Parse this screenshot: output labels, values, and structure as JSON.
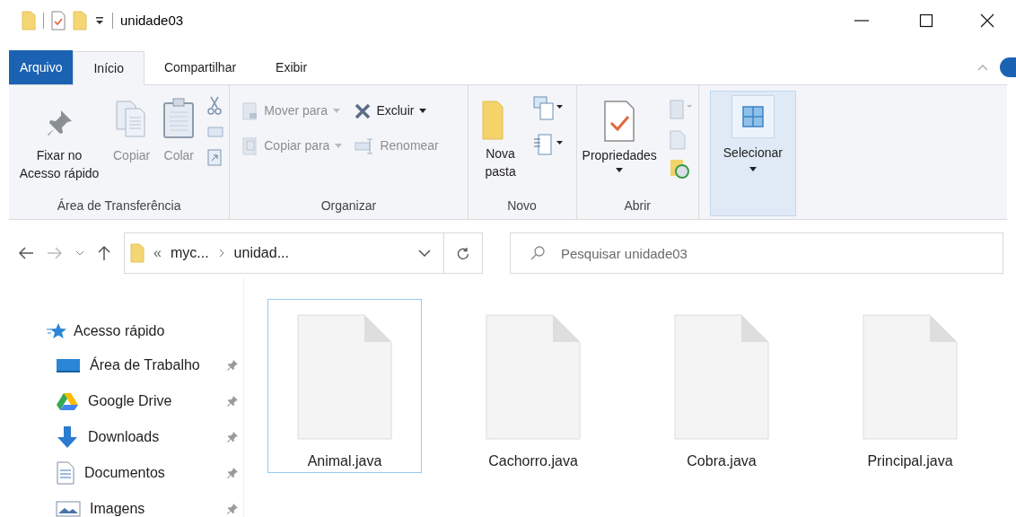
{
  "window": {
    "title": "unidade03"
  },
  "tabs": [
    {
      "label": "Arquivo",
      "kind": "file"
    },
    {
      "label": "Início",
      "kind": "tab",
      "selected": true
    },
    {
      "label": "Compartilhar",
      "kind": "tab",
      "selected": false
    },
    {
      "label": "Exibir",
      "kind": "tab",
      "selected": false
    }
  ],
  "ribbon": {
    "groups": [
      {
        "label": "Área de Transferência",
        "buttons": [
          {
            "label": "Fixar no Acesso rápido",
            "disabled": false
          },
          {
            "label": "Copiar",
            "disabled": true
          },
          {
            "label": "Colar",
            "disabled": true
          }
        ]
      },
      {
        "label": "Organizar",
        "buttons": [
          {
            "label": "Mover para",
            "disabled": true
          },
          {
            "label": "Copiar para",
            "disabled": true
          },
          {
            "label": "Excluir",
            "disabled": false
          },
          {
            "label": "Renomear",
            "disabled": true
          }
        ]
      },
      {
        "label": "Novo",
        "buttons": [
          {
            "label": "Nova pasta",
            "disabled": false
          }
        ]
      },
      {
        "label": "Abrir",
        "buttons": [
          {
            "label": "Propriedades",
            "disabled": false
          }
        ]
      },
      {
        "buttons": [
          {
            "label": "Selecionar",
            "disabled": false,
            "highlighted": true
          }
        ]
      }
    ]
  },
  "address_bar": {
    "overflow": "«",
    "crumbs": [
      "myc...",
      "unidad..."
    ]
  },
  "search": {
    "placeholder": "Pesquisar unidade03"
  },
  "sidebar": {
    "items": [
      {
        "label": "Acesso rápido",
        "children": [
          {
            "label": "Área de Trabalho",
            "pinned": true
          },
          {
            "label": "Google Drive",
            "pinned": true
          },
          {
            "label": "Downloads",
            "pinned": true
          },
          {
            "label": "Documentos",
            "pinned": true
          },
          {
            "label": "Imagens",
            "pinned": true
          }
        ]
      }
    ]
  },
  "files": [
    {
      "name": "Animal.java",
      "selected": true
    },
    {
      "name": "Cachorro.java",
      "selected": false
    },
    {
      "name": "Cobra.java",
      "selected": false
    },
    {
      "name": "Principal.java",
      "selected": false
    }
  ]
}
